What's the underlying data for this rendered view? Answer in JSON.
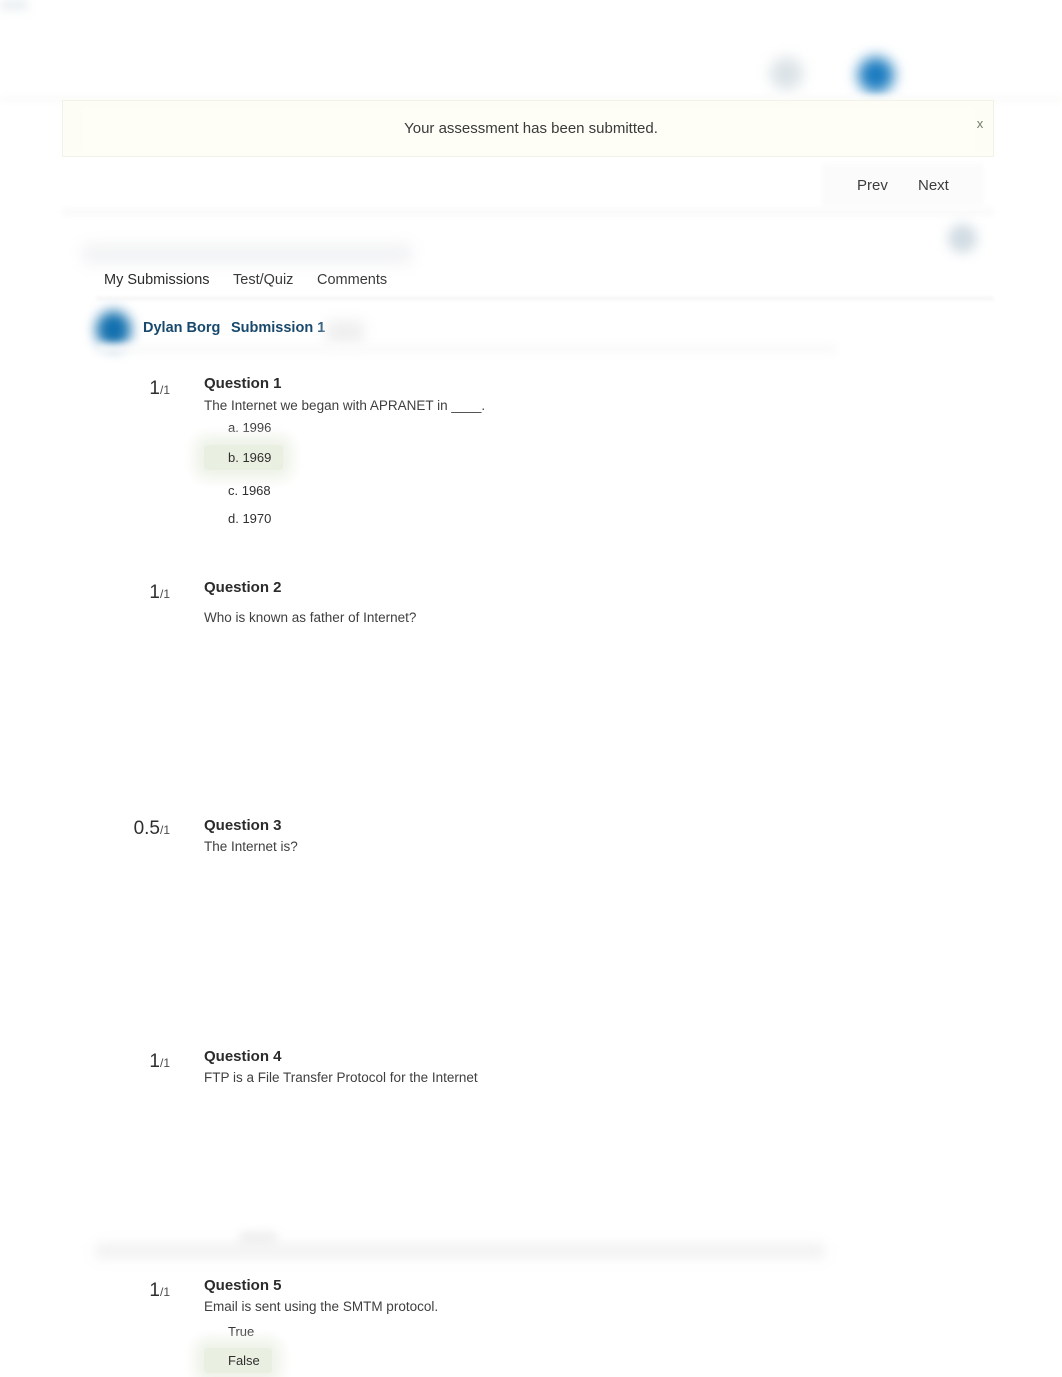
{
  "topbar": {
    "help_icon": "help-circle-icon",
    "avatar_icon": "user-avatar-icon"
  },
  "banner": {
    "message": "Your assessment has been submitted.",
    "close_label": "x",
    "background_color": "#fdfdf6"
  },
  "navigation": {
    "prev_label": "Prev",
    "next_label": "Next"
  },
  "tabs": [
    {
      "label": "My Submissions",
      "active": true
    },
    {
      "label": "Test/Quiz",
      "active": false
    },
    {
      "label": "Comments",
      "active": false
    }
  ],
  "submitter": {
    "name": "Dylan Borg",
    "submission": "Submission 1",
    "avatar_icon": "user-avatar-icon"
  },
  "questions": [
    {
      "score": "1",
      "denominator": "/1",
      "title": "Question 1",
      "text": "The Internet we began with APRANET in ____.",
      "options": [
        {
          "label": "a. 1996",
          "selected": false
        },
        {
          "label": "b. 1969",
          "selected": true
        },
        {
          "label": "c. 1968",
          "selected": false
        },
        {
          "label": "d. 1970",
          "selected": false
        }
      ]
    },
    {
      "score": "1",
      "denominator": "/1",
      "title": "Question 2",
      "text": "Who is known as father of Internet?",
      "options": []
    },
    {
      "score": "0.5",
      "denominator": "/1",
      "title": "Question 3",
      "text": "The Internet is?",
      "options": []
    },
    {
      "score": "1",
      "denominator": "/1",
      "title": "Question 4",
      "text": "FTP is a File Transfer Protocol for the Internet",
      "options": []
    },
    {
      "score": "1",
      "denominator": "/1",
      "title": "Question 5",
      "text": "Email is sent using the SMTM protocol.",
      "options": [
        {
          "label": "True",
          "selected": false
        },
        {
          "label": "False",
          "selected": true
        }
      ]
    }
  ],
  "colors": {
    "link": "#18496c",
    "selected_option_bg": "#e9efe1",
    "banner_bg": "#fdfdf6",
    "avatar_blue": "#1370ae"
  }
}
